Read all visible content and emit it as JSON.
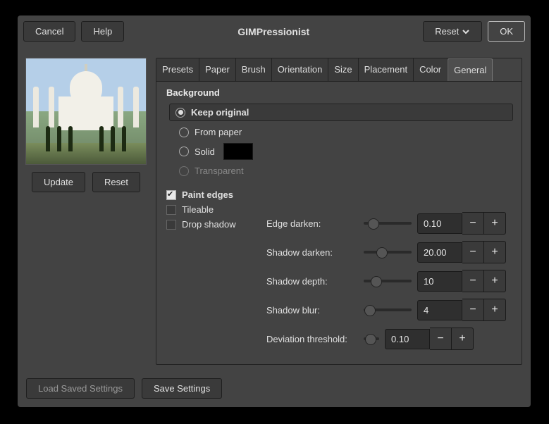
{
  "titlebar": {
    "cancel": "Cancel",
    "help": "Help",
    "title": "GIMPressionist",
    "reset": "Reset",
    "ok": "OK"
  },
  "preview": {
    "update": "Update",
    "reset": "Reset"
  },
  "tabs": [
    "Presets",
    "Paper",
    "Brush",
    "Orientation",
    "Size",
    "Placement",
    "Color",
    "General"
  ],
  "active_tab": 7,
  "background": {
    "title": "Background",
    "options": {
      "keep": "Keep original",
      "paper": "From paper",
      "solid": "Solid",
      "transparent": "Transparent"
    },
    "selected": "keep",
    "solid_color": "#000000"
  },
  "checks": {
    "paint_edges": {
      "label": "Paint edges",
      "checked": true
    },
    "tileable": {
      "label": "Tileable",
      "checked": false
    },
    "drop_shadow": {
      "label": "Drop shadow",
      "checked": false
    }
  },
  "sliders": {
    "edge_darken": {
      "label": "Edge darken:",
      "value": "0.10",
      "pos": 6
    },
    "shadow_darken": {
      "label": "Shadow darken:",
      "value": "20.00",
      "pos": 18
    },
    "shadow_depth": {
      "label": "Shadow depth:",
      "value": "10",
      "pos": 10
    },
    "shadow_blur": {
      "label": "Shadow blur:",
      "value": "4",
      "pos": 1
    },
    "deviation": {
      "label": "Deviation threshold:",
      "value": "0.10",
      "pos": 42
    }
  },
  "footer": {
    "load": "Load Saved Settings",
    "save": "Save Settings"
  }
}
